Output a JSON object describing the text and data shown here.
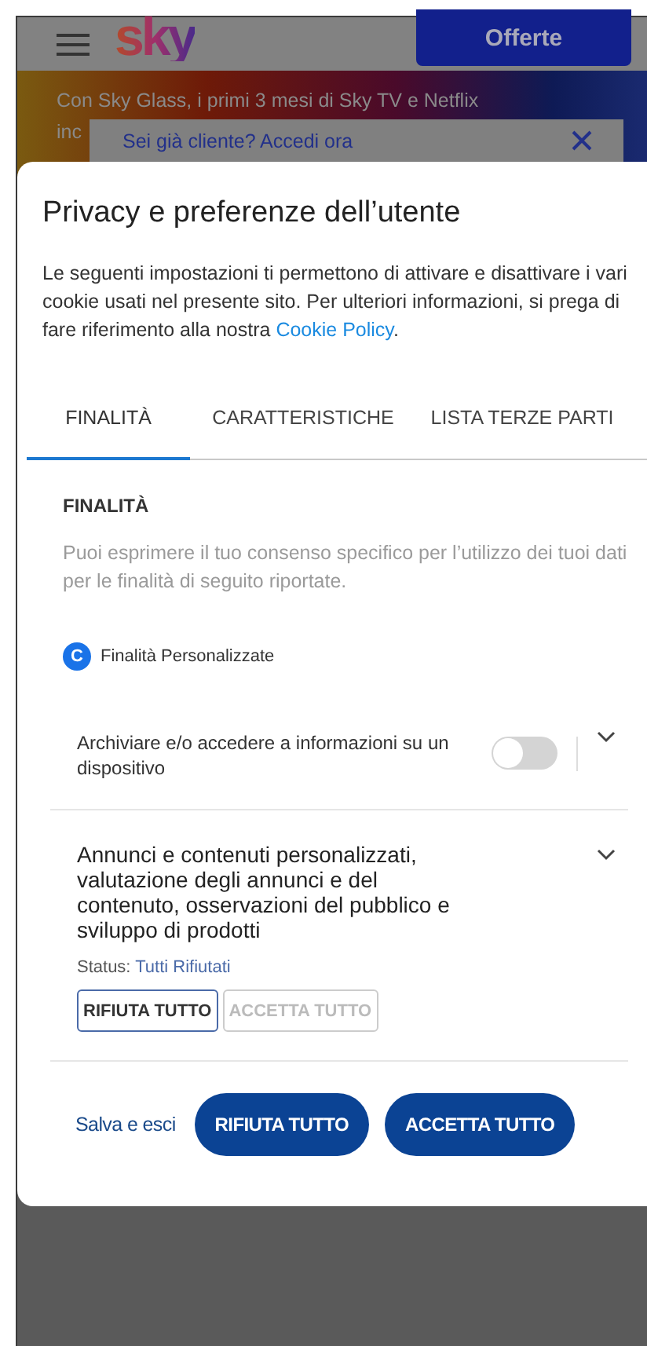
{
  "background": {
    "logo": "sky",
    "offers_button": "Offerte",
    "banner_lines": [
      "Con Sky Glass, i primi 3 mesi di Sky TV e Netflix",
      "inc"
    ],
    "login_prompt": "Sei già cliente? Accedi ora"
  },
  "dialog": {
    "title": "Privacy e preferenze dell’utente",
    "description": "Le seguenti impostazioni ti permettono di attivare e disattivare i vari cookie usati nel presente sito. Per ulteriori informazioni, si prega di fare riferimento alla nostra ",
    "link": "Cookie Policy",
    "description_end": "."
  },
  "tabs": [
    {
      "label": "FINALITÀ",
      "selected": true
    },
    {
      "label": "CARATTERISTICHE",
      "selected": false
    },
    {
      "label": "LISTA TERZE PARTI",
      "selected": false
    }
  ],
  "section": {
    "heading": "FINALITÀ",
    "description": "Puoi esprimere il tuo consenso specifico per l’utilizzo dei tuoi dati per le finalità di seguito riportate.",
    "badge": "C",
    "badge_label": "Finalità Personalizzate"
  },
  "purposes": [
    {
      "kind": "toggle",
      "label": "Archiviare e/o accedere a informazioni su un dispositivo",
      "on": false,
      "expanded": false
    },
    {
      "kind": "status",
      "label": "Annunci e contenuti personalizzati, valutazione degli annunci e del contenuto, osservazioni del pubblico e sviluppo di prodotti",
      "expanded": false,
      "status_label": "Status:",
      "status": "Tutti Rifiutati",
      "buttons": [
        {
          "label": "RIFIUTA TUTTO",
          "selected": true
        },
        {
          "label": "ACCETTA TUTTO",
          "selected": false
        }
      ]
    }
  ],
  "footer": {
    "save_link": "Salva e esci",
    "buttons": [
      "RIFIUTA TUTTO",
      "ACCETTA TUTTO"
    ]
  }
}
